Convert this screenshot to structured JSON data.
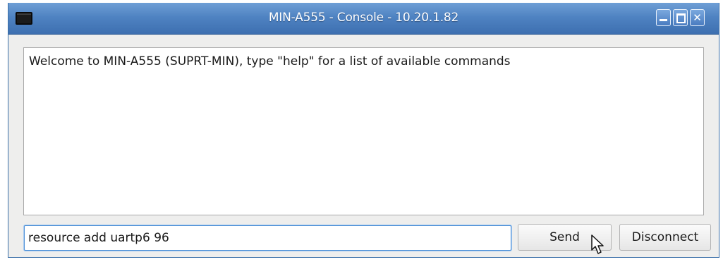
{
  "window": {
    "title": "MIN-A555 - Console - 10.20.1.82",
    "controls": {
      "minimize": "minimize",
      "maximize": "maximize",
      "close": "✕"
    }
  },
  "console": {
    "output": "Welcome to MIN-A555 (SUPRT-MIN), type \"help\" for a list of available commands"
  },
  "command": {
    "value": "resource add uartp6 96"
  },
  "buttons": {
    "send": "Send",
    "disconnect": "Disconnect"
  },
  "colors": {
    "titlebar": "#4f83c2",
    "input_focus": "#4c8fd6"
  },
  "icons": {
    "app": "terminal-icon",
    "pointer": "mouse-pointer-icon"
  }
}
